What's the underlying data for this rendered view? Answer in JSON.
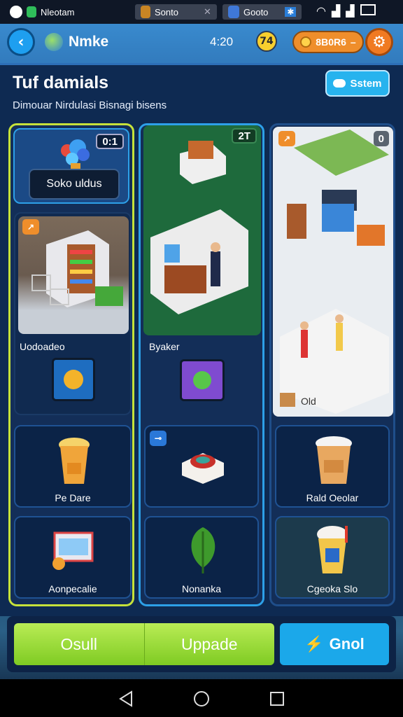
{
  "status_bar": {
    "left_label": "Nleotam",
    "mid_label": "Sonto",
    "right_label": "Gooto"
  },
  "topbar": {
    "app_name": "Nmke",
    "time": "4:20",
    "coin_badge": "74",
    "currency_label": "8B0R6"
  },
  "header": {
    "title": "Tuf damials",
    "subtitle": "Dimouar Nirdulasi Bisnagi bisens",
    "status_button": "Sstem"
  },
  "columns": [
    {
      "top_card": {
        "badge": "0:1",
        "label": "Soko uldus"
      },
      "main_card": {
        "label": "Uodoadeo"
      },
      "cards": [
        {
          "label": "Pe Dare",
          "icon": "iced-coffee-icon"
        },
        {
          "label": "Aonpecalie",
          "icon": "register-icon"
        }
      ]
    },
    {
      "top_card": {
        "badge": "2T"
      },
      "main_card": {
        "label": "Byaker"
      },
      "cards": [
        {
          "label": "",
          "icon": "sushi-platter-icon"
        },
        {
          "label": "Nonanka",
          "icon": "leaf-icon"
        }
      ]
    },
    {
      "top_card": {
        "badge": "0"
      },
      "main_card": {
        "label": "Old"
      },
      "cards": [
        {
          "label": "Rald Oeolar",
          "icon": "coffee-cup-icon"
        },
        {
          "label": "Cgeoka Slo",
          "icon": "ice-cream-cup-icon"
        }
      ]
    }
  ],
  "bottom_bar": {
    "btn_sell": "Osull",
    "btn_upgrade": "Uppade",
    "btn_goal": "Gnol"
  },
  "colors": {
    "accent_green": "#8fd62e",
    "accent_blue": "#1ba8ea",
    "accent_orange": "#ef8e2b",
    "panel_dark": "#0e2a52"
  }
}
